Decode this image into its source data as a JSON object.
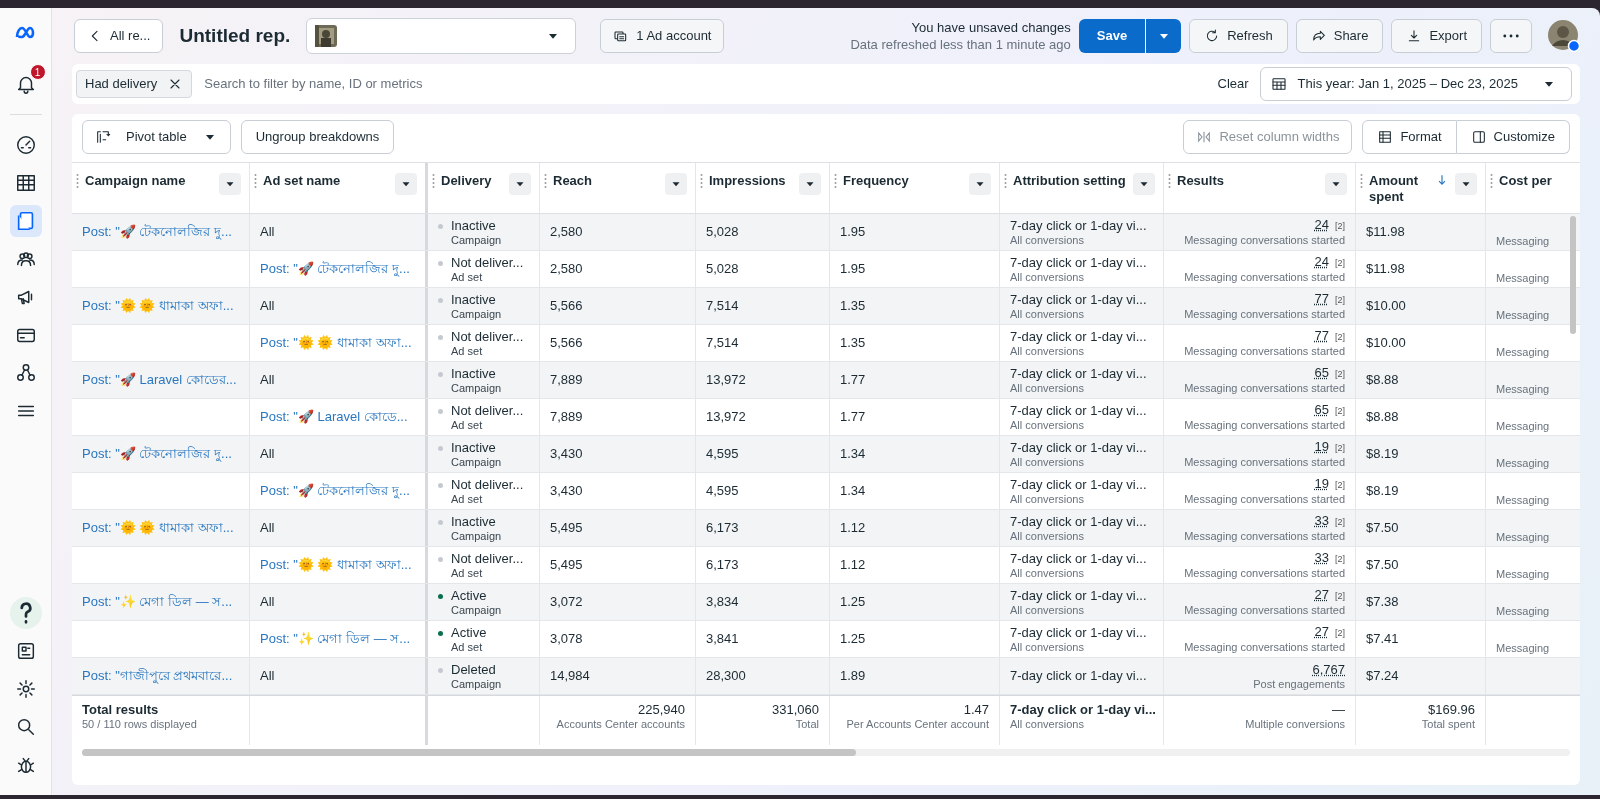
{
  "sidebar": {
    "notification_count": "1",
    "items": [
      {
        "selected": false
      },
      {
        "selected": false
      },
      {
        "selected": true
      },
      {
        "selected": false
      },
      {
        "selected": false
      },
      {
        "selected": false
      },
      {
        "selected": false
      },
      {
        "selected": false
      }
    ]
  },
  "header": {
    "back_button": "All re...",
    "report_title": "Untitled rep.",
    "ad_account_button": "1 Ad account",
    "unsaved_notice": "You have unsaved changes",
    "refresh_notice": "Data refreshed less than 1 minute ago",
    "save_button": "Save",
    "buttons": [
      "Refresh",
      "Share",
      "Export"
    ]
  },
  "filter_bar": {
    "chips": [
      {
        "label": "Had delivery"
      }
    ],
    "search": {
      "placeholder": "Search to filter by name, ID or metrics"
    },
    "clear": "Clear",
    "date_range": "This year: Jan 1, 2025 – Dec 23, 2025"
  },
  "toolbar": {
    "pivot": "Pivot table",
    "ungroup": "Ungroup breakdowns",
    "reset": {
      "label": "Reset column widths",
      "disabled": true
    },
    "format": "Format",
    "customize": "Customize"
  },
  "table": {
    "columns": [
      {
        "label": "Campaign name",
        "sorted": false
      },
      {
        "label": "Ad set name",
        "sorted": false
      },
      {
        "label": "Delivery",
        "sorted": false
      },
      {
        "label": "Reach",
        "sorted": false
      },
      {
        "label": "Impressions",
        "sorted": false
      },
      {
        "label": "Frequency",
        "sorted": false
      },
      {
        "label": "Attribution setting",
        "sorted": false
      },
      {
        "label": "Results",
        "sorted": false
      },
      {
        "label": "Amount spent",
        "sorted": true
      },
      {
        "label": "Cost per",
        "sorted": false
      }
    ],
    "rows": [
      {
        "kind": "campaign",
        "campaign": "Post: \"🚀 টেকনোলজির দু...",
        "ad_set": {
          "kind": "text",
          "text": "All"
        },
        "delivery": {
          "status": "Inactive",
          "level": "Campaign",
          "color": "#c5cad1"
        },
        "reach": "2,580",
        "impressions": "5,028",
        "frequency": "1.95",
        "attribution": "7-day click or 1-day vi...",
        "attribution_sub": "All conversions",
        "result": "24",
        "result_note": "[2]",
        "result_sub": "Messaging conversations started",
        "amount": "$11.98",
        "cost_per": "Messaging"
      },
      {
        "kind": "ad_set",
        "ad_set": {
          "kind": "link",
          "text": "Post: \"🚀 টেকনোলজির দু..."
        },
        "delivery": {
          "status": "Not deliver...",
          "level": "Ad set",
          "color": "#c5cad1"
        },
        "reach": "2,580",
        "impressions": "5,028",
        "frequency": "1.95",
        "attribution": "7-day click or 1-day vi...",
        "attribution_sub": "All conversions",
        "result": "24",
        "result_note": "[2]",
        "result_sub": "Messaging conversations started",
        "amount": "$11.98",
        "cost_per": "Messaging"
      },
      {
        "kind": "campaign",
        "campaign": "Post: \"🌞 🌞 ধামাকা অফা...",
        "ad_set": {
          "kind": "text",
          "text": "All"
        },
        "delivery": {
          "status": "Inactive",
          "level": "Campaign",
          "color": "#c5cad1"
        },
        "reach": "5,566",
        "impressions": "7,514",
        "frequency": "1.35",
        "attribution": "7-day click or 1-day vi...",
        "attribution_sub": "All conversions",
        "result": "77",
        "result_note": "[2]",
        "result_sub": "Messaging conversations started",
        "amount": "$10.00",
        "cost_per": "Messaging"
      },
      {
        "kind": "ad_set",
        "ad_set": {
          "kind": "link",
          "text": "Post: \"🌞 🌞 ধামাকা অফা..."
        },
        "delivery": {
          "status": "Not deliver...",
          "level": "Ad set",
          "color": "#c5cad1"
        },
        "reach": "5,566",
        "impressions": "7,514",
        "frequency": "1.35",
        "attribution": "7-day click or 1-day vi...",
        "attribution_sub": "All conversions",
        "result": "77",
        "result_note": "[2]",
        "result_sub": "Messaging conversations started",
        "amount": "$10.00",
        "cost_per": "Messaging"
      },
      {
        "kind": "campaign",
        "campaign": "Post: \"🚀 Laravel কোডের...",
        "ad_set": {
          "kind": "text",
          "text": "All"
        },
        "delivery": {
          "status": "Inactive",
          "level": "Campaign",
          "color": "#c5cad1"
        },
        "reach": "7,889",
        "impressions": "13,972",
        "frequency": "1.77",
        "attribution": "7-day click or 1-day vi...",
        "attribution_sub": "All conversions",
        "result": "65",
        "result_note": "[2]",
        "result_sub": "Messaging conversations started",
        "amount": "$8.88",
        "cost_per": "Messaging"
      },
      {
        "kind": "ad_set",
        "ad_set": {
          "kind": "link",
          "text": "Post: \"🚀 Laravel কোডে..."
        },
        "delivery": {
          "status": "Not deliver...",
          "level": "Ad set",
          "color": "#c5cad1"
        },
        "reach": "7,889",
        "impressions": "13,972",
        "frequency": "1.77",
        "attribution": "7-day click or 1-day vi...",
        "attribution_sub": "All conversions",
        "result": "65",
        "result_note": "[2]",
        "result_sub": "Messaging conversations started",
        "amount": "$8.88",
        "cost_per": "Messaging"
      },
      {
        "kind": "campaign",
        "campaign": "Post: \"🚀 টেকনোলজির দু...",
        "ad_set": {
          "kind": "text",
          "text": "All"
        },
        "delivery": {
          "status": "Inactive",
          "level": "Campaign",
          "color": "#c5cad1"
        },
        "reach": "3,430",
        "impressions": "4,595",
        "frequency": "1.34",
        "attribution": "7-day click or 1-day vi...",
        "attribution_sub": "All conversions",
        "result": "19",
        "result_note": "[2]",
        "result_sub": "Messaging conversations started",
        "amount": "$8.19",
        "cost_per": "Messaging"
      },
      {
        "kind": "ad_set",
        "ad_set": {
          "kind": "link",
          "text": "Post: \"🚀 টেকনোলজির দু..."
        },
        "delivery": {
          "status": "Not deliver...",
          "level": "Ad set",
          "color": "#c5cad1"
        },
        "reach": "3,430",
        "impressions": "4,595",
        "frequency": "1.34",
        "attribution": "7-day click or 1-day vi...",
        "attribution_sub": "All conversions",
        "result": "19",
        "result_note": "[2]",
        "result_sub": "Messaging conversations started",
        "amount": "$8.19",
        "cost_per": "Messaging"
      },
      {
        "kind": "campaign",
        "campaign": "Post: \"🌞 🌞 ধামাকা অফা...",
        "ad_set": {
          "kind": "text",
          "text": "All"
        },
        "delivery": {
          "status": "Inactive",
          "level": "Campaign",
          "color": "#c5cad1"
        },
        "reach": "5,495",
        "impressions": "6,173",
        "frequency": "1.12",
        "attribution": "7-day click or 1-day vi...",
        "attribution_sub": "All conversions",
        "result": "33",
        "result_note": "[2]",
        "result_sub": "Messaging conversations started",
        "amount": "$7.50",
        "cost_per": "Messaging"
      },
      {
        "kind": "ad_set",
        "ad_set": {
          "kind": "link",
          "text": "Post: \"🌞 🌞 ধামাকা অফা..."
        },
        "delivery": {
          "status": "Not deliver...",
          "level": "Ad set",
          "color": "#c5cad1"
        },
        "reach": "5,495",
        "impressions": "6,173",
        "frequency": "1.12",
        "attribution": "7-day click or 1-day vi...",
        "attribution_sub": "All conversions",
        "result": "33",
        "result_note": "[2]",
        "result_sub": "Messaging conversations started",
        "amount": "$7.50",
        "cost_per": "Messaging"
      },
      {
        "kind": "campaign",
        "campaign": "Post: \"✨ মেগা ডিল — স...",
        "ad_set": {
          "kind": "text",
          "text": "All"
        },
        "delivery": {
          "status": "Active",
          "level": "Campaign",
          "color": "#0b6e4f"
        },
        "reach": "3,072",
        "impressions": "3,834",
        "frequency": "1.25",
        "attribution": "7-day click or 1-day vi...",
        "attribution_sub": "All conversions",
        "result": "27",
        "result_note": "[2]",
        "result_sub": "Messaging conversations started",
        "amount": "$7.38",
        "cost_per": "Messaging"
      },
      {
        "kind": "ad_set",
        "ad_set": {
          "kind": "link",
          "text": "Post: \"✨ মেগা ডিল — স..."
        },
        "delivery": {
          "status": "Active",
          "level": "Ad set",
          "color": "#0b6e4f"
        },
        "reach": "3,078",
        "impressions": "3,841",
        "frequency": "1.25",
        "attribution": "7-day click or 1-day vi...",
        "attribution_sub": "All conversions",
        "result": "27",
        "result_note": "[2]",
        "result_sub": "Messaging conversations started",
        "amount": "$7.41",
        "cost_per": "Messaging"
      },
      {
        "kind": "campaign",
        "campaign": "Post: \"গাজীপুরে প্রথমবারে...",
        "ad_set": {
          "kind": "text",
          "text": "All"
        },
        "delivery": {
          "status": "Deleted",
          "level": "Campaign",
          "color": "#c5cad1"
        },
        "reach": "14,984",
        "impressions": "28,300",
        "frequency": "1.89",
        "attribution": "7-day click or 1-day vi...",
        "result": "6,767",
        "result_sub": "Post engagements",
        "amount": "$7.24"
      }
    ],
    "totals": {
      "label": "Total results",
      "rows_displayed": "50 / 110 rows displayed",
      "reach": "225,940",
      "reach_sub": "Accounts Center accounts",
      "impressions": "331,060",
      "impressions_sub": "Total",
      "frequency": "1.47",
      "frequency_sub": "Per Accounts Center account",
      "attribution": "7-day click or 1-day vi...",
      "attribution_sub": "All conversions",
      "results": "—",
      "results_sub": "Multiple conversions",
      "amount": "$169.96",
      "amount_sub": "Total spent"
    }
  }
}
